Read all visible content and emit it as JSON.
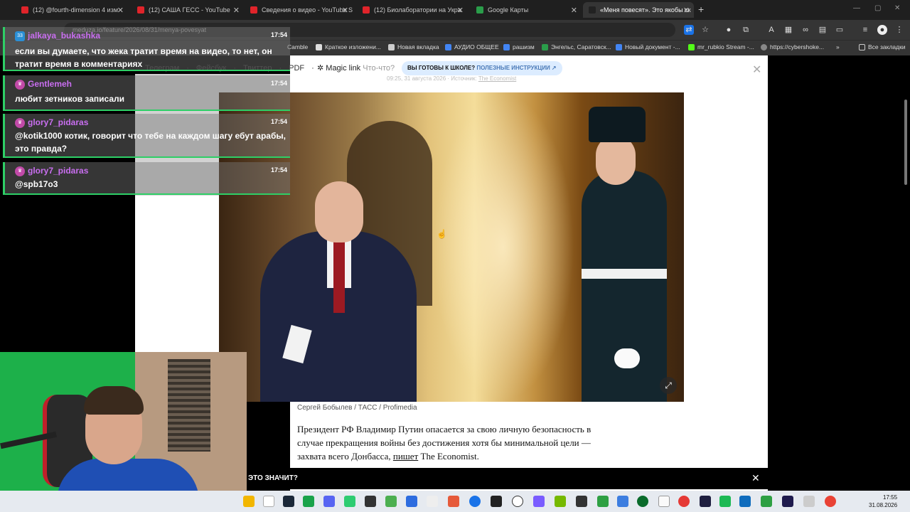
{
  "tabs": [
    {
      "label": "(12) @fourth-dimension 4 изм",
      "color": "#e0242a"
    },
    {
      "label": "(12) САША ГЕСС - YouTube",
      "color": "#e0242a"
    },
    {
      "label": "Сведения о видео - YouTube S",
      "color": "#e0242a"
    },
    {
      "label": "(12) Биолаборатории на Укра",
      "color": "#e0242a"
    },
    {
      "label": "Google Карты",
      "color": "#2a9d4a"
    },
    {
      "label": "«Меня повесят». Это якобы ск",
      "color": "#222222",
      "active": true
    }
  ],
  "address": "meduza.io/feature/2026/08/31/menya-povesyat",
  "bookmarks": [
    "Camble",
    "Краткое изложени...",
    "Новая вкладка",
    "АУДИО ОБЩЕЕ",
    "рашизм",
    "Энгельс, Саратовск...",
    "Новый документ -...",
    "mr_rubkio Stream -...",
    "https://cybershoke...",
    "»",
    "Все закладки"
  ],
  "page": {
    "share_links": [
      "Телеграм",
      "·",
      "Фейсбук",
      "·",
      "Твиттер",
      "·",
      "PDF",
      "·"
    ],
    "magic_link": "Magic link",
    "magic_q": "Что-что?",
    "school_main": "ВЫ ГОТОВЫ К ШКОЛЕ?",
    "school_sub": "ПОЛЕЗНЫЕ ИНСТРУКЦИИ ↗",
    "meta": "09:25, 31 августа 2026 · Источник:",
    "meta_source": "The Economist",
    "caption": "Сергей Бобылев / ТАСС / Profimedia",
    "article_p1": "Президент РФ Владимир Путин опасается за свою личную безопасность в случае прекращения войны без достижения хотя бы минимальной цели — захвата всего Донбасса, ",
    "article_link": "пишет",
    "article_p2": " The Economist.",
    "banner": "ЭТО ЗНАЧИТ?"
  },
  "chat": [
    {
      "user": "jalkaya_bukashka",
      "badge": "33",
      "time": "17:54",
      "text": "если вы думаете, что жека тратит время на видео, то нет, он тратит время в комментариях"
    },
    {
      "user": "Gentlemeh",
      "badge": "♛",
      "time": "17:54",
      "text": "любит зетников записали"
    },
    {
      "user": "glory7_pidaras",
      "badge": "♛",
      "time": "17:54",
      "text": "@kotik1000 котик, говорит что тебе на каждом шагу ебут арабы, это правда?"
    },
    {
      "user": "glory7_pidaras",
      "badge": "♛",
      "time": "17:54",
      "text": "@spb17o3"
    }
  ],
  "clock": {
    "time": "17:55",
    "date": "31.08.2026"
  },
  "accent": "#2ecf66"
}
